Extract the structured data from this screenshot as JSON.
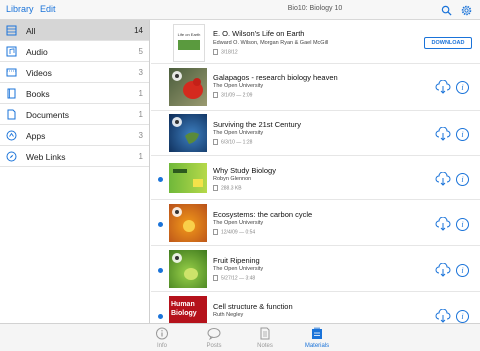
{
  "topbar": {
    "library_label": "Library",
    "edit_label": "Edit",
    "title": "Bio10: Biology 10"
  },
  "sidebar": {
    "items": [
      {
        "label": "All",
        "count": "14",
        "icon": "all-icon",
        "selected": true
      },
      {
        "label": "Audio",
        "count": "5",
        "icon": "audio-icon"
      },
      {
        "label": "Videos",
        "count": "3",
        "icon": "video-icon"
      },
      {
        "label": "Books",
        "count": "1",
        "icon": "book-icon"
      },
      {
        "label": "Documents",
        "count": "1",
        "icon": "document-icon"
      },
      {
        "label": "Apps",
        "count": "3",
        "icon": "apps-icon"
      },
      {
        "label": "Web Links",
        "count": "1",
        "icon": "compass-icon"
      }
    ]
  },
  "items": [
    {
      "title": "E. O. Wilson's Life on Earth",
      "author": "Edward O. Wilson, Morgan Ryan & Gael McGill",
      "meta": "3/18/12",
      "action": "DOWNLOAD",
      "cover_title": "Life on Earth",
      "unread": false
    },
    {
      "title": "Galapagos - research biology heaven",
      "author": "The Open University",
      "meta": "3/1/09 — 2:09",
      "unread": false
    },
    {
      "title": "Surviving the 21st Century",
      "author": "The Open University",
      "meta": "6/3/10 — 1:28",
      "unread": false
    },
    {
      "title": "Why Study Biology",
      "author": "Robyn Glennon",
      "meta": "288.3 KB",
      "unread": true
    },
    {
      "title": "Ecosystems: the carbon cycle",
      "author": "The Open University",
      "meta": "12/4/09 — 0:54",
      "unread": true
    },
    {
      "title": "Fruit Ripening",
      "author": "The Open University",
      "meta": "5/27/12 — 3:48",
      "unread": true
    },
    {
      "title": "Cell structure & function",
      "author": "Ruth Negley",
      "meta": "",
      "cover_text": "Human Biology",
      "unread": true
    }
  ],
  "tabs": [
    {
      "label": "Info",
      "icon": "info-icon"
    },
    {
      "label": "Posts",
      "icon": "speech-bubble-icon"
    },
    {
      "label": "Notes",
      "icon": "note-icon"
    },
    {
      "label": "Materials",
      "icon": "materials-icon",
      "active": true
    }
  ],
  "colors": {
    "accent": "#1a73d9",
    "unread_dot": "#1a73d9",
    "selected_row": "#d6d6d6"
  }
}
